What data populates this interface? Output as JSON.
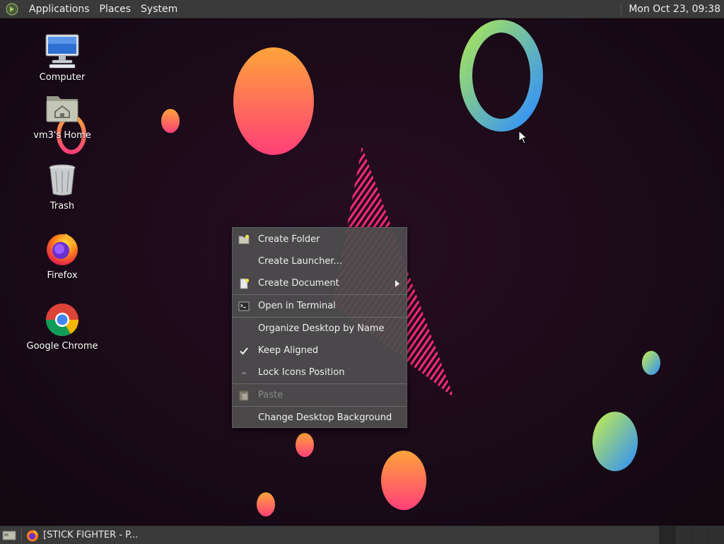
{
  "top_panel": {
    "logo_icon": "mate-menu-icon",
    "menus": [
      "Applications",
      "Places",
      "System"
    ],
    "clock": "Mon Oct 23, 09:38"
  },
  "desktop_icons": [
    {
      "name": "computer-icon",
      "label": "Computer"
    },
    {
      "name": "home-folder-icon",
      "label": "vm3's Home"
    },
    {
      "name": "trash-icon",
      "label": "Trash"
    },
    {
      "name": "firefox-icon",
      "label": "Firefox"
    },
    {
      "name": "chrome-icon",
      "label": "Google Chrome"
    }
  ],
  "context_menu": {
    "items": [
      {
        "label": "Create Folder",
        "icon": "folder-new-icon"
      },
      {
        "label": "Create Launcher...",
        "icon": ""
      },
      {
        "label": "Create Document",
        "icon": "document-new-icon",
        "submenu": true
      },
      {
        "label": "Open in Terminal",
        "icon": "terminal-icon"
      },
      {
        "label": "Organize Desktop by Name",
        "icon": ""
      },
      {
        "label": "Keep Aligned",
        "icon": "check-icon",
        "checked": true
      },
      {
        "label": "Lock Icons Position",
        "icon": "unchecked-icon"
      },
      {
        "label": "Paste",
        "icon": "paste-icon",
        "disabled": true
      },
      {
        "label": "Change Desktop Background",
        "icon": ""
      }
    ]
  },
  "bottom_panel": {
    "show_desktop_icon": "show-desktop-icon",
    "task": {
      "label": "[STICK FIGHTER - P...",
      "icon": "firefox-icon"
    },
    "workspaces": 4
  },
  "colors": {
    "panel": "#3a3a3a",
    "background": "#1e0c1e",
    "accent_pink": "#ff2e7a",
    "accent_orange": "#ffa040"
  }
}
